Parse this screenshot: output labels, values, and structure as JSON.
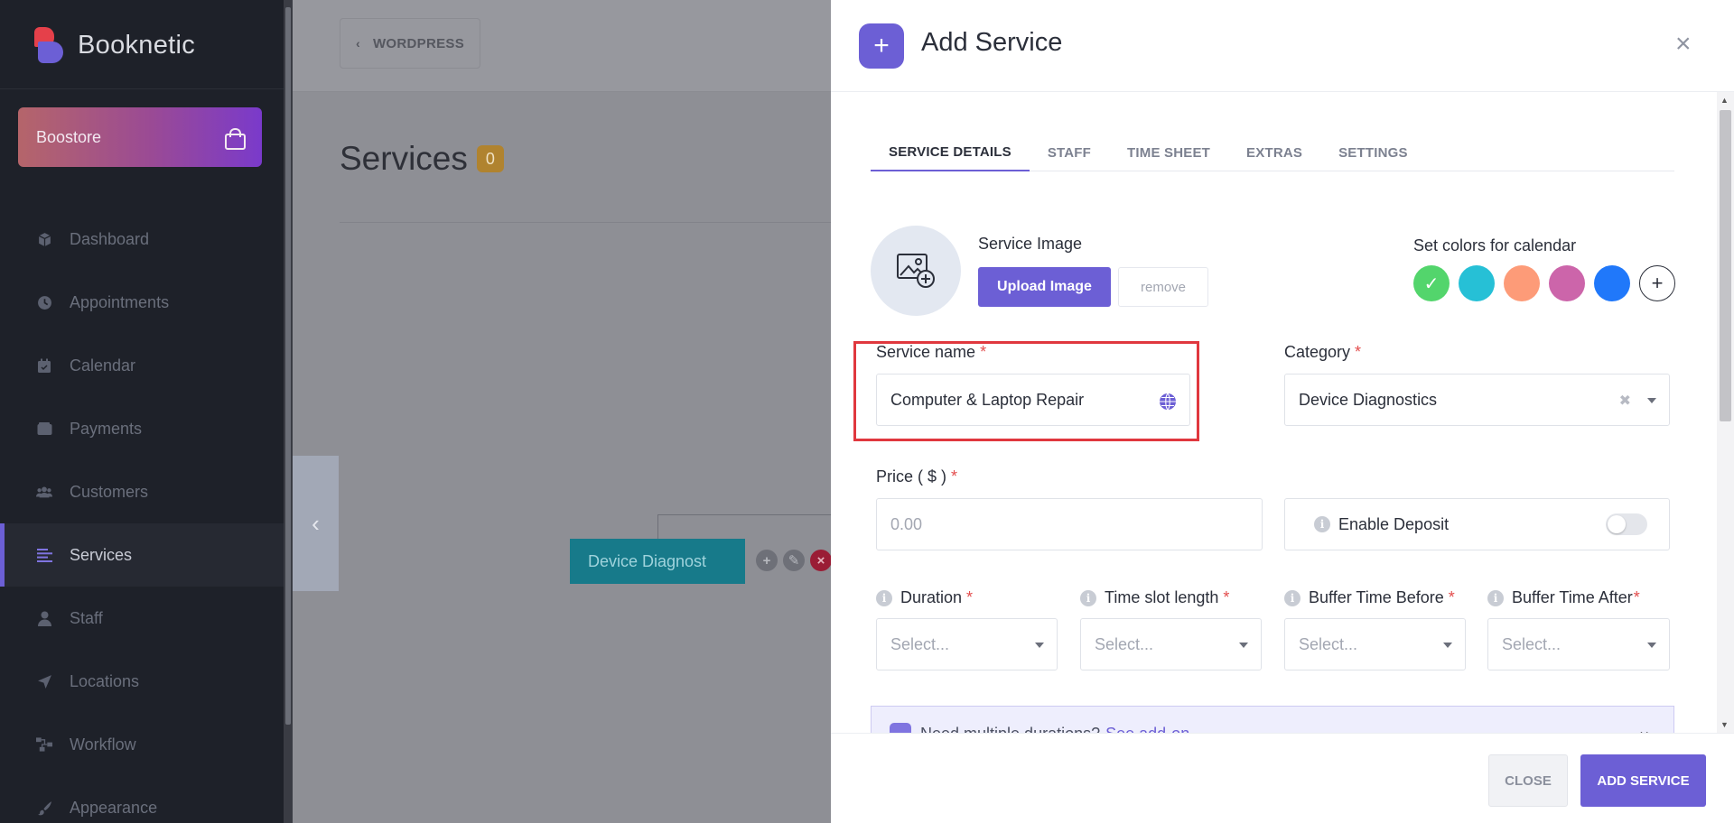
{
  "brand": {
    "name": "Booknetic"
  },
  "boostore": {
    "label": "Boostore"
  },
  "nav": {
    "items": [
      {
        "label": "Dashboard",
        "icon": "cube-icon"
      },
      {
        "label": "Appointments",
        "icon": "clock-icon"
      },
      {
        "label": "Calendar",
        "icon": "calendar-icon"
      },
      {
        "label": "Payments",
        "icon": "wallet-icon"
      },
      {
        "label": "Customers",
        "icon": "users-icon"
      },
      {
        "label": "Services",
        "icon": "list-icon",
        "active": true
      },
      {
        "label": "Staff",
        "icon": "user-icon"
      },
      {
        "label": "Locations",
        "icon": "location-arrow-icon"
      },
      {
        "label": "Workflow",
        "icon": "workflow-icon"
      },
      {
        "label": "Appearance",
        "icon": "brush-icon"
      }
    ]
  },
  "main": {
    "back_label": "WORDPRESS",
    "title": "Services",
    "count": "0",
    "node_label": "Device Diagnost"
  },
  "modal": {
    "title": "Add Service",
    "tabs": [
      "SERVICE DETAILS",
      "STAFF",
      "TIME SHEET",
      "EXTRAS",
      "SETTINGS"
    ],
    "service_image_label": "Service Image",
    "upload_label": "Upload Image",
    "remove_label": "remove",
    "colors_label": "Set colors for calendar",
    "swatches": [
      "#53d56c",
      "#26c0d6",
      "#fd9b78",
      "#cc65aa",
      "#2078fa"
    ],
    "service_name": {
      "label": "Service name",
      "required": "*",
      "value": "Computer & Laptop Repair"
    },
    "category": {
      "label": "Category",
      "required": "*",
      "value": "Device Diagnostics"
    },
    "price": {
      "label": "Price ( $ )",
      "required": "*",
      "placeholder": "0.00"
    },
    "deposit": {
      "label": "Enable Deposit",
      "enabled": false
    },
    "duration": {
      "label": "Duration",
      "required": "*",
      "placeholder": "Select..."
    },
    "time_slot": {
      "label": "Time slot length",
      "required": "*",
      "placeholder": "Select..."
    },
    "buffer_before": {
      "label": "Buffer Time Before",
      "required": "*",
      "placeholder": "Select..."
    },
    "buffer_after": {
      "label": "Buffer Time After",
      "required": "*",
      "placeholder": "Select..."
    },
    "promo": {
      "text": "Need multiple durations?",
      "link": "See add-on"
    },
    "close_label": "CLOSE",
    "add_label": "ADD SERVICE"
  },
  "colors": {
    "accent": "#6c5fd5",
    "sidebar": "#1e2129",
    "highlight": "#e0383e"
  }
}
